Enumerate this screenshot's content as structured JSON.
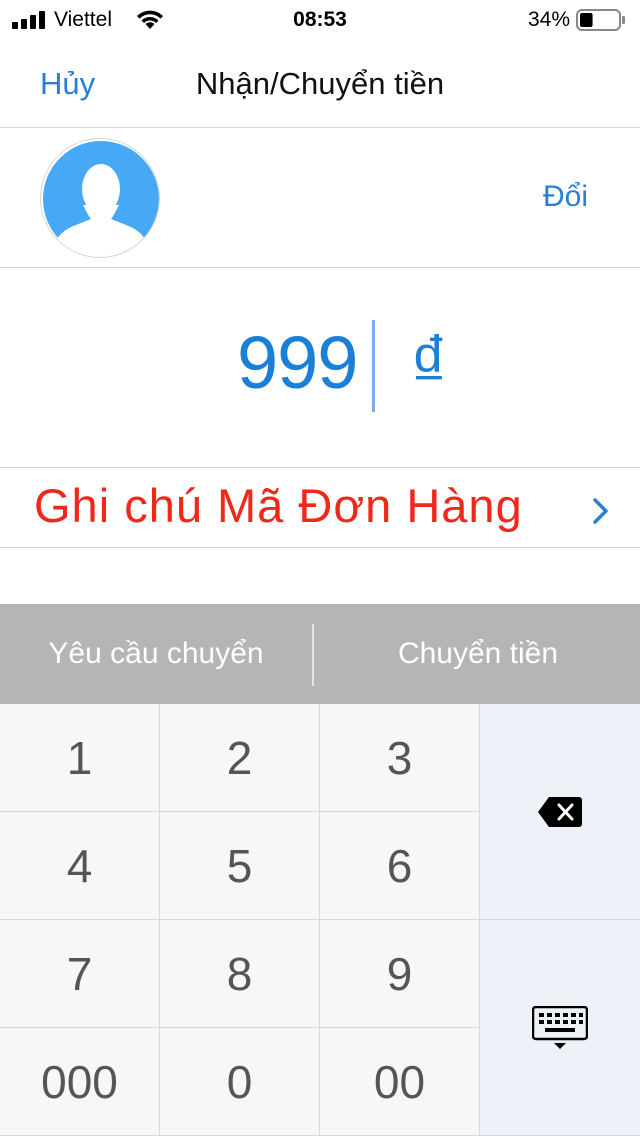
{
  "status_bar": {
    "carrier": "Viettel",
    "time": "08:53",
    "battery_percent": "34%",
    "battery_level": 0.34
  },
  "nav": {
    "cancel_label": "Hủy",
    "title": "Nhận/Chuyển tiền"
  },
  "recipient": {
    "change_label": "Đổi"
  },
  "amount": {
    "value": "999",
    "currency": "₫"
  },
  "note": {
    "label": "Ghi chú Mã Đơn Hàng"
  },
  "tabs": {
    "request_label": "Yêu cầu chuyển",
    "transfer_label": "Chuyển tiền"
  },
  "keypad": {
    "keys": [
      "1",
      "2",
      "3",
      "4",
      "5",
      "6",
      "7",
      "8",
      "9",
      "000",
      "0",
      "00"
    ]
  },
  "colors": {
    "accent": "#2a7fd4",
    "amount": "#1a7fd6",
    "note": "#f0271a",
    "tab_bg": "#b5b5b5",
    "avatar_bg": "#47a9f5"
  }
}
